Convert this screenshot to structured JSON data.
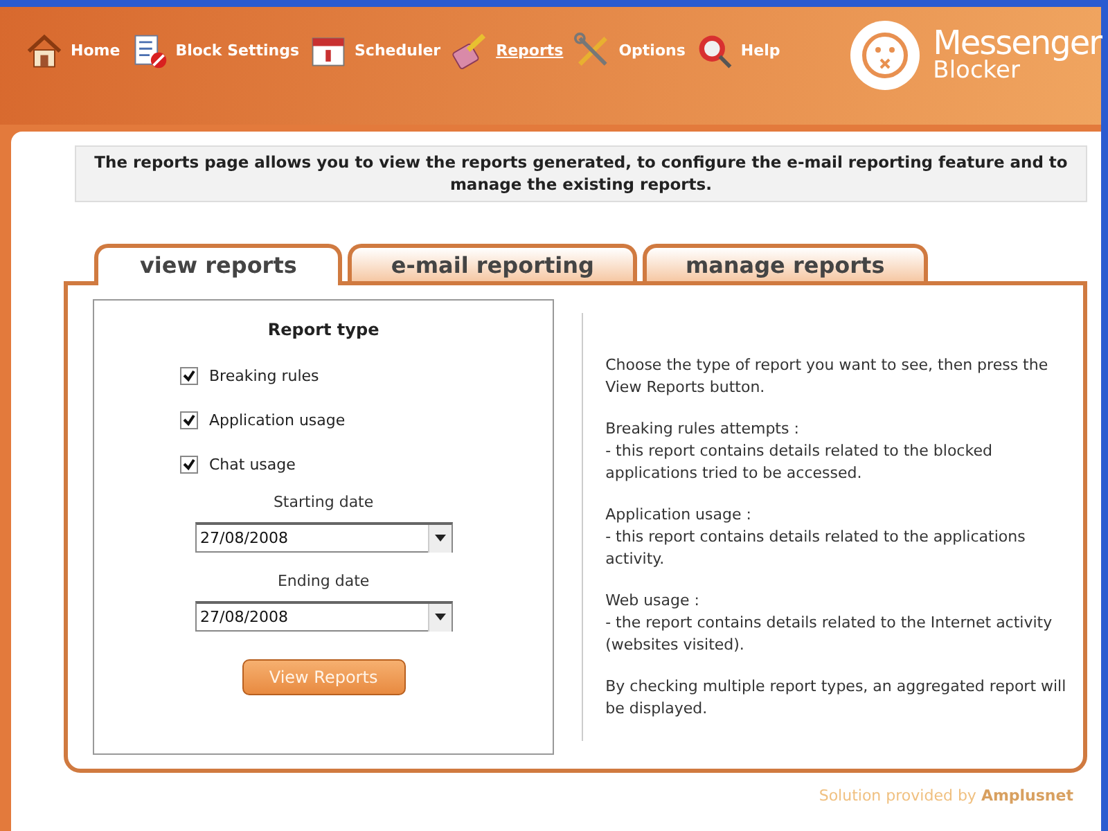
{
  "nav": [
    {
      "label": "Home",
      "selected": false
    },
    {
      "label": "Block Settings",
      "selected": false
    },
    {
      "label": "Scheduler",
      "selected": false
    },
    {
      "label": "Reports",
      "selected": true
    },
    {
      "label": "Options",
      "selected": false
    },
    {
      "label": "Help",
      "selected": false
    }
  ],
  "logo": {
    "title": "Messenger",
    "subtitle": "Blocker"
  },
  "intro": "The reports page allows you to view the reports generated, to configure the e-mail reporting feature and to manage the existing reports.",
  "tabs": [
    {
      "label": "view reports",
      "selected": true
    },
    {
      "label": "e-mail reporting",
      "selected": false
    },
    {
      "label": "manage reports",
      "selected": false
    }
  ],
  "report_type": {
    "title": "Report type",
    "options": [
      {
        "label": "Breaking rules",
        "checked": true
      },
      {
        "label": "Application usage",
        "checked": true
      },
      {
        "label": "Chat usage",
        "checked": true
      }
    ],
    "starting_date": {
      "label": "Starting date",
      "value": "27/08/2008"
    },
    "ending_date": {
      "label": "Ending date",
      "value": "27/08/2008"
    },
    "button": "View Reports"
  },
  "help_paragraphs": [
    "Choose the type of report you want to see, then press the View Reports button.",
    "Breaking rules attempts :\n- this report contains details related to the blocked applications tried to be accessed.",
    "Application usage :\n- this report contains details related to the applications activity.",
    "Web usage :\n- the report contains details related to the Internet activity (websites visited).",
    "By checking multiple report types, an aggregated report will be displayed."
  ],
  "footer": "Solution provided by **Amplusnet**"
}
